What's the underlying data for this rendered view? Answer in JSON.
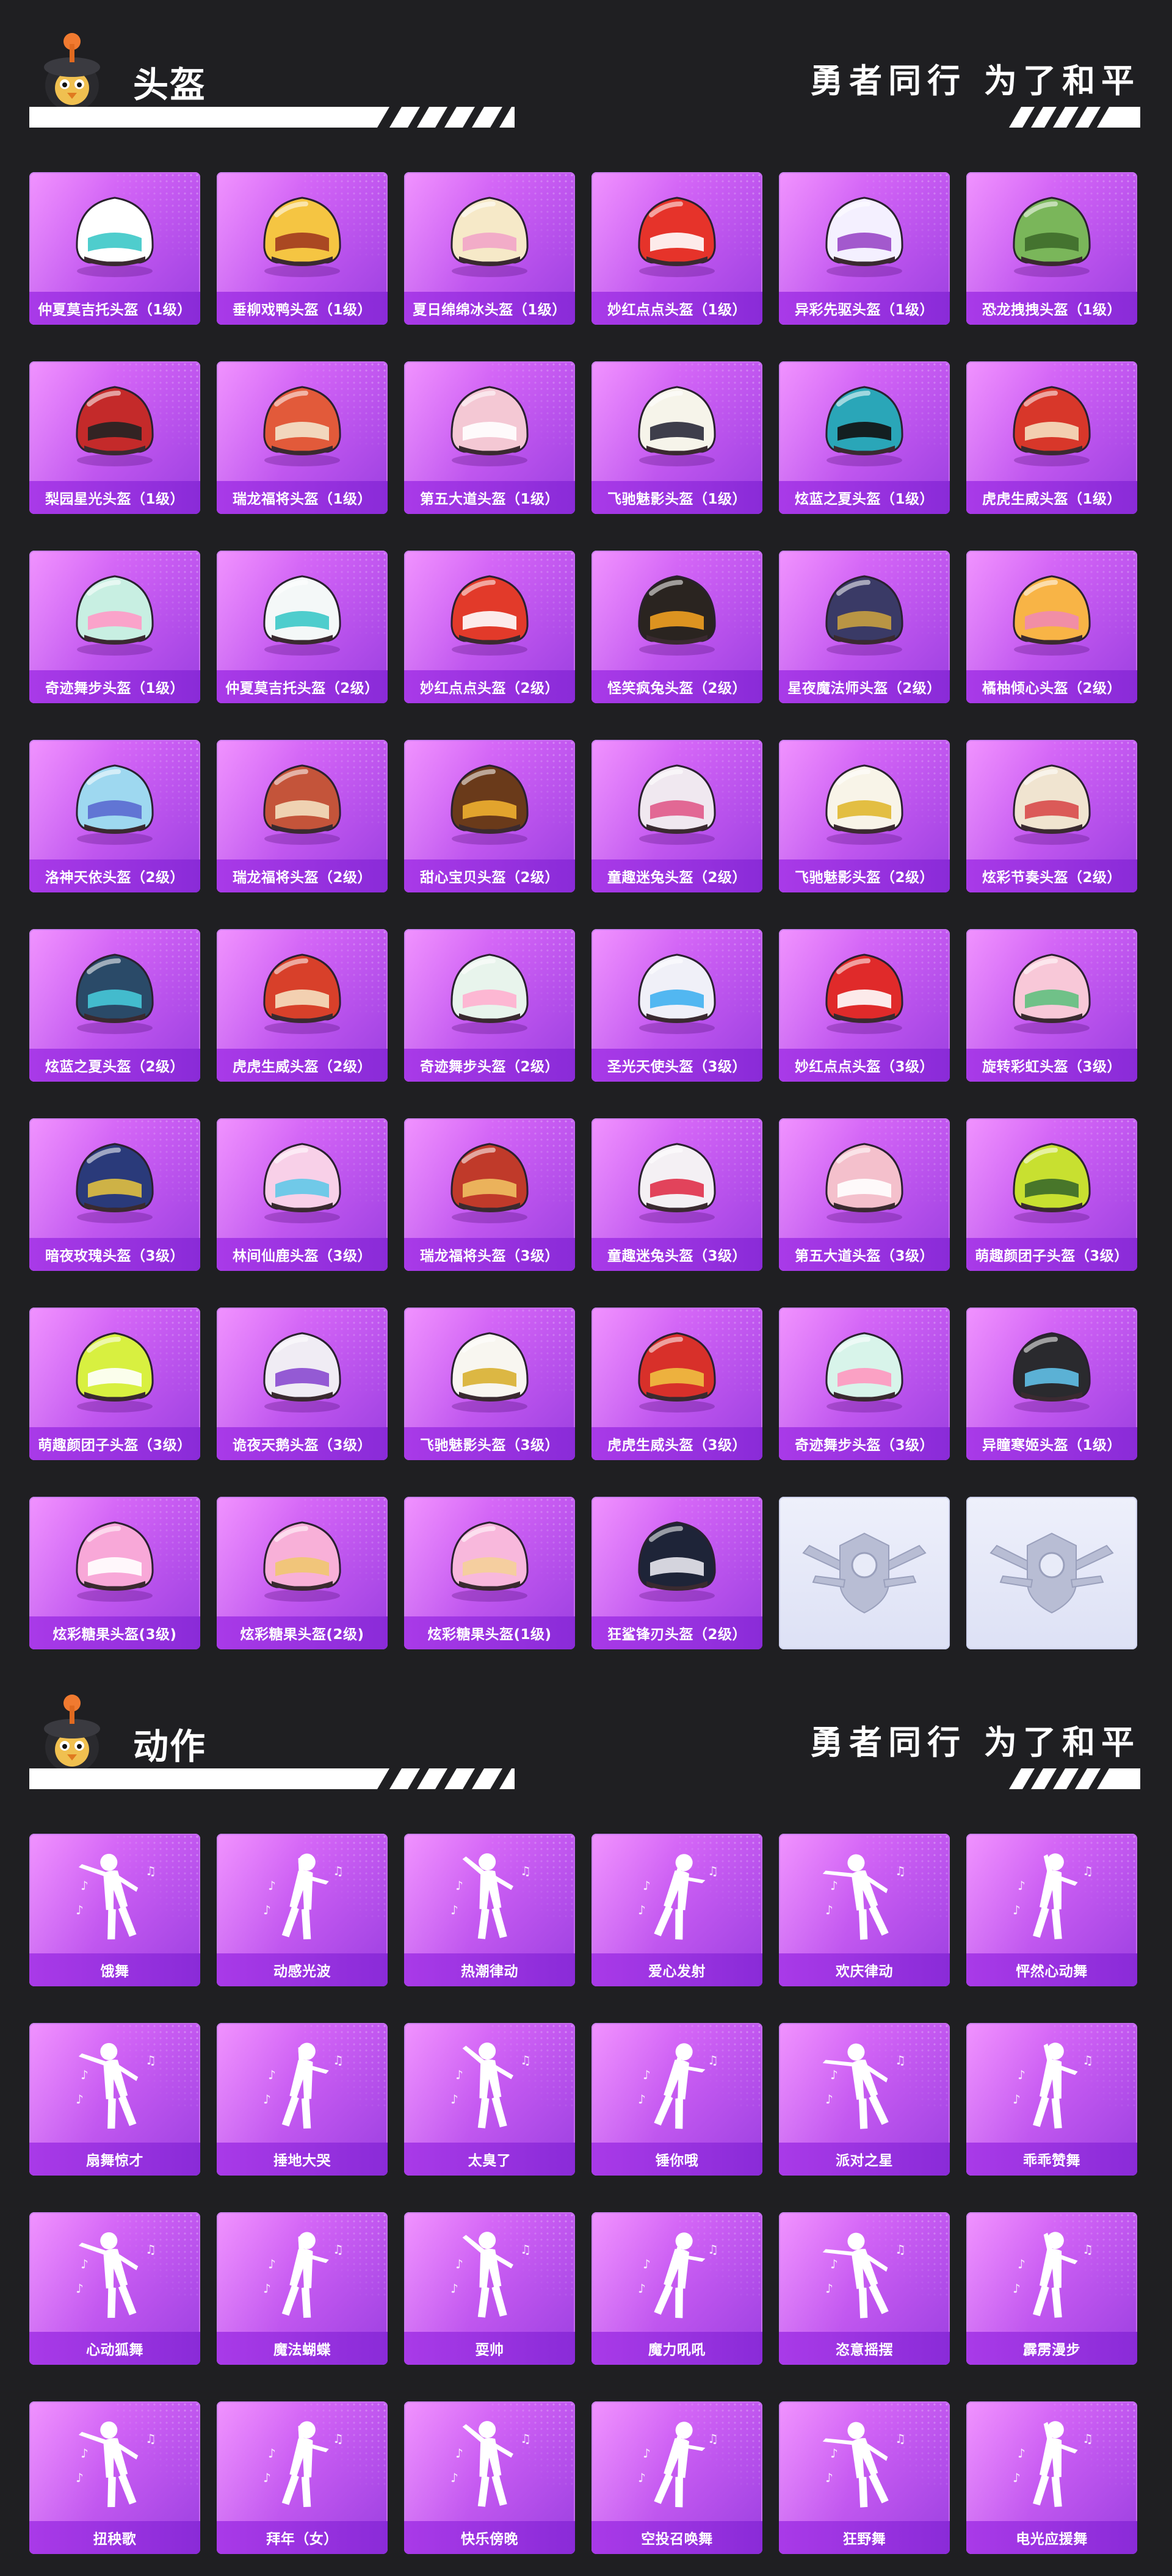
{
  "header_slogan": "勇者同行 为了和平",
  "sections": {
    "helmets": {
      "title": "头盔",
      "items": [
        {
          "label": "仲夏莫吉托头盔（1级）",
          "color": "#ffffff",
          "accent": "#3cc8c8",
          "icon": "helmet-icon"
        },
        {
          "label": "垂柳戏鸭头盔（1级）",
          "color": "#f5c542",
          "accent": "#a23a1f",
          "icon": "helmet-icon"
        },
        {
          "label": "夏日绵绵冰头盔（1级）",
          "color": "#f6e9c8",
          "accent": "#f2a5c8",
          "icon": "helmet-icon"
        },
        {
          "label": "妙红点点头盔（1级）",
          "color": "#e6332a",
          "accent": "#ffffff",
          "icon": "helmet-icon"
        },
        {
          "label": "异彩先驱头盔（1级）",
          "color": "#f4f0ff",
          "accent": "#9a48c8",
          "icon": "helmet-icon"
        },
        {
          "label": "恐龙拽拽头盔（1级）",
          "color": "#7ab65a",
          "accent": "#3e6b2a",
          "icon": "helmet-icon"
        },
        {
          "label": "梨园星光头盔（1级）",
          "color": "#c42a2a",
          "accent": "#222222",
          "icon": "helmet-icon"
        },
        {
          "label": "瑞龙福将头盔（1级）",
          "color": "#e25a3a",
          "accent": "#f4e4cc",
          "icon": "helmet-icon"
        },
        {
          "label": "第五大道头盔（1级）",
          "color": "#f4c8d4",
          "accent": "#ffffff",
          "icon": "helmet-icon"
        },
        {
          "label": "飞驰魅影头盔（1级）",
          "color": "#f6f4ea",
          "accent": "#2a2a3a",
          "icon": "helmet-icon"
        },
        {
          "label": "炫蓝之夏头盔（1级）",
          "color": "#2aa6b8",
          "accent": "#111111",
          "icon": "helmet-icon"
        },
        {
          "label": "虎虎生威头盔（1级）",
          "color": "#d8372a",
          "accent": "#f6e0c0",
          "icon": "helmet-icon"
        },
        {
          "label": "奇迹舞步头盔（1级）",
          "color": "#c8efe2",
          "accent": "#ff9ac8",
          "icon": "helmet-icon"
        },
        {
          "label": "仲夏莫吉托头盔（2级）",
          "color": "#f4f8f8",
          "accent": "#3cc8c8",
          "icon": "helmet-icon"
        },
        {
          "label": "妙红点点头盔（2级）",
          "color": "#e23a2a",
          "accent": "#ffffff",
          "icon": "helmet-icon"
        },
        {
          "label": "怪笑疯兔头盔（2级）",
          "color": "#2a2420",
          "accent": "#f0a020",
          "icon": "helmet-icon"
        },
        {
          "label": "星夜魔法师头盔（2级）",
          "color": "#3a3a66",
          "accent": "#c8a040",
          "icon": "helmet-icon"
        },
        {
          "label": "橘柚倾心头盔（2级）",
          "color": "#f8b446",
          "accent": "#f08ab0",
          "icon": "helmet-icon"
        },
        {
          "label": "洛神天依头盔（2级）",
          "color": "#9ed8f0",
          "accent": "#5a6ad0",
          "icon": "helmet-icon"
        },
        {
          "label": "瑞龙福将头盔（2级）",
          "color": "#c4543a",
          "accent": "#f4e0c0",
          "icon": "helmet-icon"
        },
        {
          "label": "甜心宝贝头盔（2级）",
          "color": "#6a3a1a",
          "accent": "#f0b030",
          "icon": "helmet-icon"
        },
        {
          "label": "童趣迷兔头盔（2级）",
          "color": "#f0e8f0",
          "accent": "#e05a8a",
          "icon": "helmet-icon"
        },
        {
          "label": "飞驰魅影头盔（2级）",
          "color": "#f8f4e8",
          "accent": "#e0b830",
          "icon": "helmet-icon"
        },
        {
          "label": "炫彩节奏头盔（2级）",
          "color": "#f0e4d0",
          "accent": "#d84a4a",
          "icon": "helmet-icon"
        },
        {
          "label": "炫蓝之夏头盔（2级）",
          "color": "#2a4a68",
          "accent": "#46c8d8",
          "icon": "helmet-icon"
        },
        {
          "label": "虎虎生威头盔（2级）",
          "color": "#d8402a",
          "accent": "#f6e0c0",
          "icon": "helmet-icon"
        },
        {
          "label": "奇迹舞步头盔（2级）",
          "color": "#e8f4ec",
          "accent": "#ffb0d0",
          "icon": "helmet-icon"
        },
        {
          "label": "圣光天使头盔（3级）",
          "color": "#f0f0f8",
          "accent": "#40b0f0",
          "icon": "helmet-icon"
        },
        {
          "label": "妙红点点头盔（3级）",
          "color": "#e02a2a",
          "accent": "#ffffff",
          "icon": "helmet-icon"
        },
        {
          "label": "旋转彩虹头盔（3级）",
          "color": "#f8c8d8",
          "accent": "#60c080",
          "icon": "helmet-icon"
        },
        {
          "label": "暗夜玫瑰头盔（3级）",
          "color": "#2a3a7a",
          "accent": "#e0c040",
          "icon": "helmet-icon"
        },
        {
          "label": "林间仙鹿头盔（3级）",
          "color": "#f8d0e8",
          "accent": "#60c8e8",
          "icon": "helmet-icon"
        },
        {
          "label": "瑞龙福将头盔（3级）",
          "color": "#c03a2a",
          "accent": "#f0c060",
          "icon": "helmet-icon"
        },
        {
          "label": "童趣迷兔头盔（3级）",
          "color": "#f4f0f4",
          "accent": "#e0304a",
          "icon": "helmet-icon"
        },
        {
          "label": "第五大道头盔（3级）",
          "color": "#f4c0cc",
          "accent": "#ffffff",
          "icon": "helmet-icon"
        },
        {
          "label": "萌趣颜团子头盔（3级）",
          "color": "#c8e030",
          "accent": "#3a6a2a",
          "icon": "helmet-icon"
        },
        {
          "label": "萌趣颜团子头盔（3级）",
          "color": "#d8f040",
          "accent": "#ffffff",
          "icon": "helmet-icon"
        },
        {
          "label": "诡夜天鹅头盔（3级）",
          "color": "#f0ecf4",
          "accent": "#8a4ad0",
          "icon": "helmet-icon"
        },
        {
          "label": "飞驰魅影头盔（3级）",
          "color": "#f8f6f0",
          "accent": "#d8b030",
          "icon": "helmet-icon"
        },
        {
          "label": "虎虎生威头盔（3级）",
          "color": "#d8302a",
          "accent": "#f0c040",
          "icon": "helmet-icon"
        },
        {
          "label": "奇迹舞步头盔（3级）",
          "color": "#d8f4ea",
          "accent": "#ff98c0",
          "icon": "helmet-icon"
        },
        {
          "label": "异瞳寒姬头盔（1级）",
          "color": "#2a2a2e",
          "accent": "#60c0e8",
          "icon": "helmet-icon"
        },
        {
          "label": "炫彩糖果头盔(3级)",
          "color": "#f8a8d8",
          "accent": "#ffffff",
          "icon": "helmet-icon"
        },
        {
          "label": "炫彩糖果头盔(2级)",
          "color": "#f8b0d8",
          "accent": "#f0c870",
          "icon": "helmet-icon"
        },
        {
          "label": "炫彩糖果头盔(1级)",
          "color": "#f8b8dc",
          "accent": "#f4d098",
          "icon": "helmet-icon"
        },
        {
          "label": "狂鲨锋刃头盔（2级）",
          "color": "#1e2438",
          "accent": "#e8e8f0",
          "icon": "helmet-icon"
        },
        {
          "label": "",
          "empty": true,
          "icon": "pubg-emblem-icon"
        },
        {
          "label": "",
          "empty": true,
          "icon": "pubg-emblem-icon"
        }
      ]
    },
    "emotes": {
      "title": "动作",
      "items": [
        {
          "label": "饿舞",
          "icon": "dancer-silhouette-icon"
        },
        {
          "label": "动感光波",
          "icon": "dancer-silhouette-icon"
        },
        {
          "label": "热潮律动",
          "icon": "dancer-silhouette-icon"
        },
        {
          "label": "爱心发射",
          "icon": "dancer-silhouette-icon"
        },
        {
          "label": "欢庆律动",
          "icon": "dancer-silhouette-icon"
        },
        {
          "label": "怦然心动舞",
          "icon": "dancer-silhouette-icon"
        },
        {
          "label": "扇舞惊才",
          "icon": "dancer-silhouette-icon"
        },
        {
          "label": "捶地大哭",
          "icon": "dancer-silhouette-icon"
        },
        {
          "label": "太臭了",
          "icon": "dancer-silhouette-icon"
        },
        {
          "label": "锤你哦",
          "icon": "dancer-silhouette-icon"
        },
        {
          "label": "派对之星",
          "icon": "dancer-silhouette-icon"
        },
        {
          "label": "乖乖赞舞",
          "icon": "dancer-silhouette-icon"
        },
        {
          "label": "心动狐舞",
          "icon": "dancer-silhouette-icon"
        },
        {
          "label": "魔法蝴蝶",
          "icon": "dancer-silhouette-icon"
        },
        {
          "label": "耍帅",
          "icon": "dancer-silhouette-icon"
        },
        {
          "label": "魔力吼吼",
          "icon": "dancer-silhouette-icon"
        },
        {
          "label": "恣意摇摆",
          "icon": "dancer-silhouette-icon"
        },
        {
          "label": "霹雳漫步",
          "icon": "dancer-silhouette-icon"
        },
        {
          "label": "扭秧歌",
          "icon": "dancer-silhouette-icon"
        },
        {
          "label": "拜年（女）",
          "icon": "dancer-silhouette-icon"
        },
        {
          "label": "快乐傍晚",
          "icon": "dancer-silhouette-icon"
        },
        {
          "label": "空投召唤舞",
          "icon": "dancer-silhouette-icon"
        },
        {
          "label": "狂野舞",
          "icon": "dancer-silhouette-icon"
        },
        {
          "label": "电光应援舞",
          "icon": "dancer-silhouette-icon"
        }
      ]
    }
  }
}
